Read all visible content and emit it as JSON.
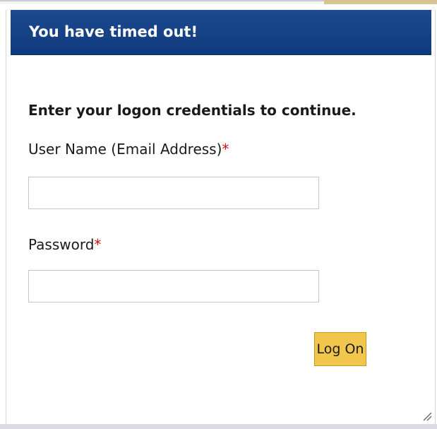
{
  "dialog": {
    "title": "You have timed out!",
    "instruction": "Enter your logon credentials to continue.",
    "username": {
      "label": "User Name (Email Address)",
      "required_marker": "*",
      "value": ""
    },
    "password": {
      "label": "Password",
      "required_marker": "*",
      "value": ""
    },
    "logon_button_label": "Log On",
    "resize_icon": "resize-grip-icon"
  },
  "colors": {
    "titlebar": "#0f3a7c",
    "button": "#f2c54d",
    "required": "#cc1111"
  }
}
